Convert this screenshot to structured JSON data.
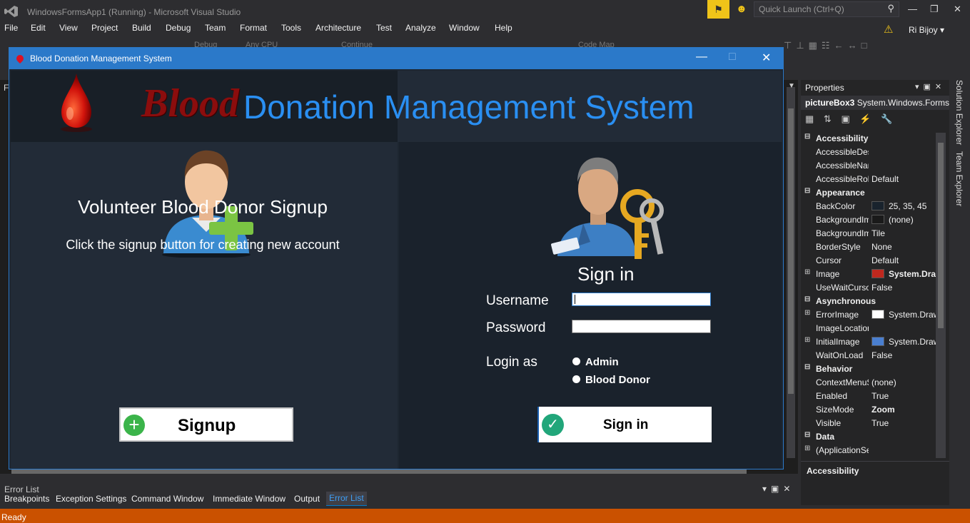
{
  "vs": {
    "title": "WindowsFormsApp1 (Running) - Microsoft Visual Studio",
    "quick_launch_placeholder": "Quick Launch (Ctrl+Q)",
    "user": "Ri Bijoy",
    "menu": [
      "File",
      "Edit",
      "View",
      "Project",
      "Build",
      "Debug",
      "Team",
      "Format",
      "Tools",
      "Architecture",
      "Test",
      "Analyze",
      "Window",
      "Help"
    ],
    "toolbar": {
      "config": "Debug",
      "platform": "Any CPU",
      "continue": "Continue",
      "codemap": "Code Map"
    },
    "editor_tab_letter": "F"
  },
  "form": {
    "title": "Blood Donation Management System",
    "banner_blood": "Blood",
    "banner_rest": "Donation Management System",
    "left": {
      "heading": "Volunteer Blood Donor Signup",
      "subtext": "Click the signup button for creating new account",
      "signup_label": "Signup"
    },
    "right": {
      "heading": "Sign in",
      "username_label": "Username",
      "password_label": "Password",
      "login_as_label": "Login as",
      "radio_admin": "Admin",
      "radio_donor": "Blood Donor",
      "signin_label": "Sign in",
      "username_value": "",
      "password_value": ""
    }
  },
  "properties": {
    "title": "Properties",
    "object_name": "pictureBox3",
    "object_type": "System.Windows.Forms.PictureBox",
    "rows": [
      {
        "type": "cat",
        "name": "Accessibility"
      },
      {
        "type": "prop",
        "name": "AccessibleDescription",
        "value": ""
      },
      {
        "type": "prop",
        "name": "AccessibleName",
        "value": ""
      },
      {
        "type": "prop",
        "name": "AccessibleRole",
        "value": "Default"
      },
      {
        "type": "cat",
        "name": "Appearance"
      },
      {
        "type": "prop",
        "name": "BackColor",
        "value": "25, 35, 45",
        "swatch": "#19232d"
      },
      {
        "type": "prop",
        "name": "BackgroundImage",
        "value": "(none)",
        "swatch": "#1a1a1a"
      },
      {
        "type": "prop",
        "name": "BackgroundImageLayout",
        "value": "Tile"
      },
      {
        "type": "prop",
        "name": "BorderStyle",
        "value": "None"
      },
      {
        "type": "prop",
        "name": "Cursor",
        "value": "Default"
      },
      {
        "type": "prop",
        "name": "Image",
        "value": "System.Drawing.Bitmap",
        "bold": true,
        "expand": true,
        "swatch": "#c0281e"
      },
      {
        "type": "prop",
        "name": "UseWaitCursor",
        "value": "False"
      },
      {
        "type": "cat",
        "name": "Asynchronous"
      },
      {
        "type": "prop",
        "name": "ErrorImage",
        "value": "System.Drawing.Bitmap",
        "expand": true,
        "swatch": "#ffffff"
      },
      {
        "type": "prop",
        "name": "ImageLocation",
        "value": ""
      },
      {
        "type": "prop",
        "name": "InitialImage",
        "value": "System.Drawing.Bitmap",
        "expand": true,
        "swatch": "#4a7fd0"
      },
      {
        "type": "prop",
        "name": "WaitOnLoad",
        "value": "False"
      },
      {
        "type": "cat",
        "name": "Behavior"
      },
      {
        "type": "prop",
        "name": "ContextMenuStrip",
        "value": "(none)"
      },
      {
        "type": "prop",
        "name": "Enabled",
        "value": "True"
      },
      {
        "type": "prop",
        "name": "SizeMode",
        "value": "Zoom",
        "bold": true
      },
      {
        "type": "prop",
        "name": "Visible",
        "value": "True"
      },
      {
        "type": "cat",
        "name": "Data"
      },
      {
        "type": "prop",
        "name": "(ApplicationSettings)",
        "value": "",
        "expand": true
      }
    ],
    "description_title": "Accessibility"
  },
  "side_tabs": [
    "Solution Explorer",
    "Team Explorer"
  ],
  "bottom": {
    "panel_title": "Error List",
    "tabs": [
      "Breakpoints",
      "Exception Settings",
      "Command Window",
      "Immediate Window",
      "Output",
      "Error List"
    ],
    "active_tab": "Error List"
  },
  "status": "Ready",
  "colors": {
    "accent": "#2b79c9",
    "status_bar": "#ca5100",
    "banner_blue": "#2a8ff2",
    "blood_red": "#8b0d0d"
  }
}
